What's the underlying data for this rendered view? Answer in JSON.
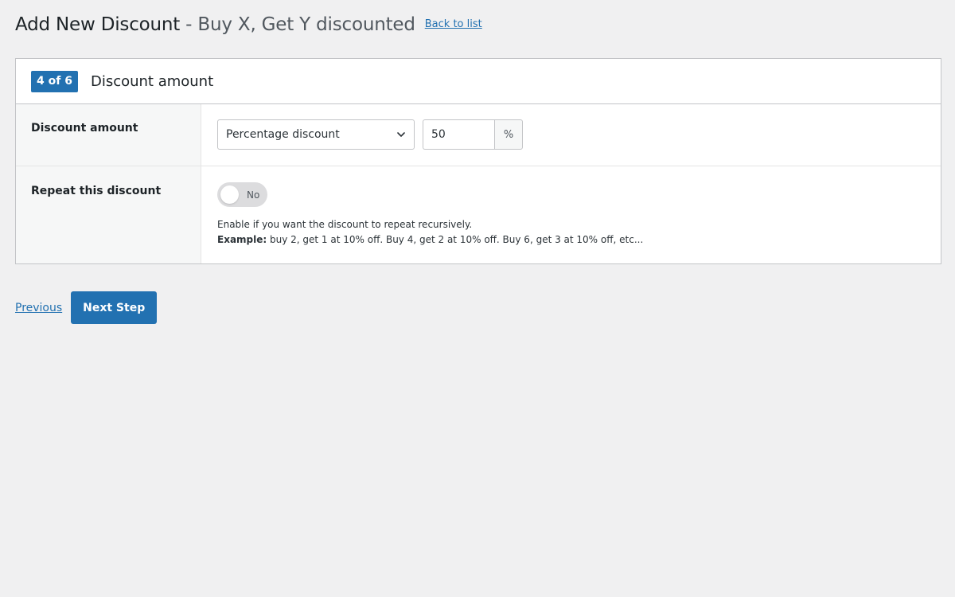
{
  "header": {
    "title": "Add New Discount",
    "separator": "-",
    "subtitle": "Buy X, Get Y discounted",
    "back_link": "Back to list"
  },
  "panel": {
    "step_badge": "4 of 6",
    "title": "Discount amount"
  },
  "discount_amount": {
    "label": "Discount amount",
    "type_selected": "Percentage discount",
    "amount_value": "50",
    "amount_unit": "%"
  },
  "repeat": {
    "label": "Repeat this discount",
    "toggle_state": "No",
    "help_text": "Enable if you want the discount to repeat recursively.",
    "example_label": "Example:",
    "example_text": " buy 2, get 1 at 10% off. Buy 4, get 2 at 10% off. Buy 6, get 3 at 10% off, etc..."
  },
  "footer": {
    "previous_label": "Previous",
    "next_label": "Next Step"
  },
  "colors": {
    "accent": "#2271b1",
    "background": "#f0f0f1",
    "toggle_off": "#dcdcde"
  }
}
